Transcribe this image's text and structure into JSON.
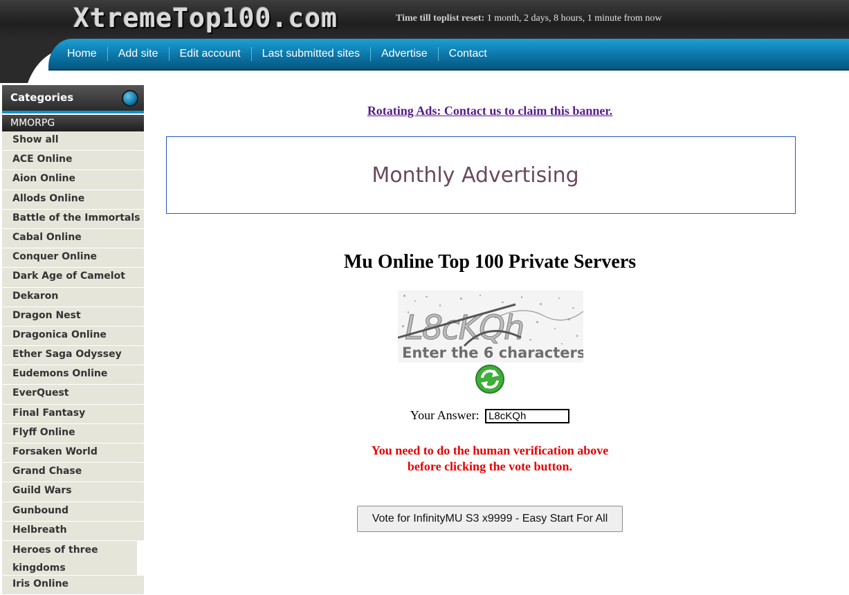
{
  "header": {
    "logo": "XtremeTop100.com",
    "reset_label": "Time till toplist reset:",
    "reset_value": " 1 month, 2 days, 8 hours, 1 minute from now",
    "nav": [
      "Home",
      "Add site",
      "Edit account",
      "Last submitted sites",
      "Advertise",
      "Contact"
    ]
  },
  "sidebar": {
    "title": "Categories",
    "group": "MMORPG",
    "items": [
      "Show all",
      "ACE Online",
      "Aion Online",
      "Allods Online",
      "Battle of the Immortals",
      "Cabal Online",
      "Conquer Online",
      "Dark Age of Camelot",
      "Dekaron",
      "Dragon Nest",
      "Dragonica Online",
      "Ether Saga Odyssey",
      "Eudemons Online",
      "EverQuest",
      "Final Fantasy",
      "Flyff Online",
      "Forsaken World",
      "Grand Chase",
      "Guild Wars",
      "Gunbound",
      "Helbreath",
      "Heroes of three kingdoms",
      "Iris Online"
    ]
  },
  "main": {
    "ad_link": "Rotating Ads: Contact us to claim this banner.",
    "banner_text": "Monthly Advertising",
    "title": "Mu Online Top 100 Private Servers",
    "captcha_code": "L8cKQh",
    "captcha_hint": "Enter the 6 characters.",
    "answer_label": "Your Answer:",
    "answer_value": "L8cKQh",
    "warning_line1": "You need to do the human verification above",
    "warning_line2": "before clicking the vote button.",
    "vote_button": "Vote for InfinityMU S3 x9999 - Easy Start For All"
  },
  "colors": {
    "nav_blue": "#0b76a8",
    "accent_blue": "#1591c6",
    "warning_red": "#e60000",
    "link_purple": "#551a8b",
    "sidebar_bg": "#e6e5da"
  }
}
